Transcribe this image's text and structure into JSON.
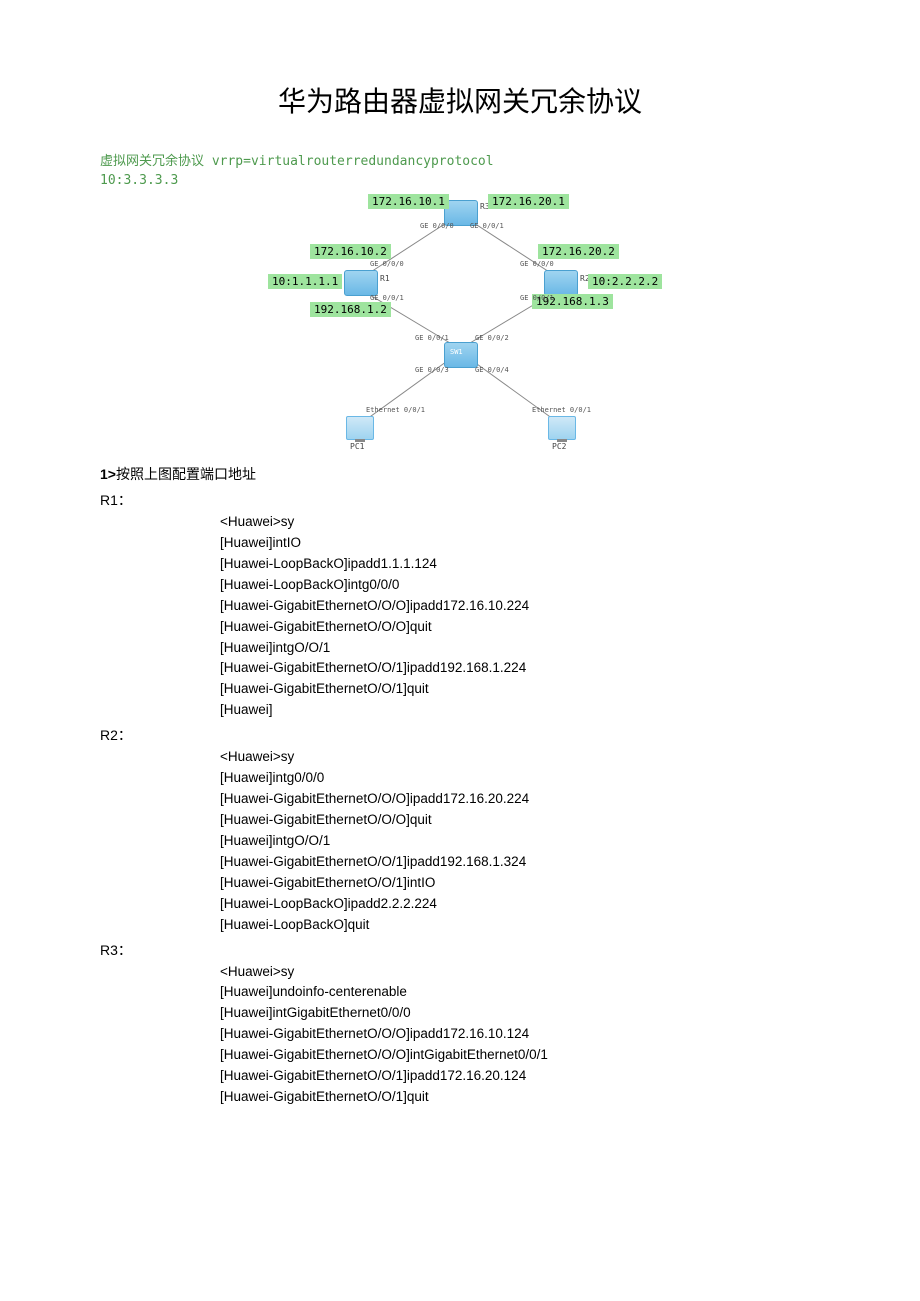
{
  "title": "华为路由器虚拟网关冗余协议",
  "greenHeading": "虚拟网关冗余协议 vrrp=virtualrouterredundancyprotocol",
  "greenSub": "10:3.3.3.3",
  "diagram": {
    "ips": {
      "r3_left": "172.16.10.1",
      "r3_right": "172.16.20.1",
      "r1_up": "172.16.10.2",
      "r2_up": "172.16.20.2",
      "r1_lo": "10:1.1.1.1",
      "r2_lo": "10:2.2.2.2",
      "r1_down": "192.168.1.2",
      "r2_down": "192.168.1.3"
    },
    "ports": {
      "ge000": "GE 0/0/0",
      "ge001": "GE 0/0/1",
      "ge002": "GE 0/0/2",
      "ge003": "GE 0/0/3",
      "ge004": "GE 0/0/4",
      "eth001": "Ethernet 0/0/1"
    },
    "devices": {
      "r1": "R1",
      "r2": "R2",
      "r3": "R3",
      "sw1": "SW1",
      "pc1": "PC1",
      "pc2": "PC2"
    }
  },
  "sectionHeading": "按照上图配置端口地址",
  "sectionNum": "1>",
  "r1Label": "R1：",
  "r1": [
    "<Huawei>sy",
    "[Huawei]intIO",
    "[Huawei-LoopBackO]ipadd1.1.1.124",
    "[Huawei-LoopBackO]intg0/0/0",
    "[Huawei-GigabitEthernetO/O/O]ipadd172.16.10.224",
    "[Huawei-GigabitEthernetO/O/O]quit",
    "[Huawei]intgO/O/1",
    "[Huawei-GigabitEthernetO/O/1]ipadd192.168.1.224",
    "[Huawei-GigabitEthernetO/O/1]quit",
    "[Huawei]"
  ],
  "r2Label": "R2：",
  "r2": [
    "<Huawei>sy",
    "[Huawei]intg0/0/0",
    "[Huawei-GigabitEthernetO/O/O]ipadd172.16.20.224",
    "[Huawei-GigabitEthernetO/O/O]quit",
    "[Huawei]intgO/O/1",
    "[Huawei-GigabitEthernetO/O/1]ipadd192.168.1.324",
    "[Huawei-GigabitEthernetO/O/1]intIO",
    "[Huawei-LoopBackO]ipadd2.2.2.224",
    "[Huawei-LoopBackO]quit"
  ],
  "r3Label": "R3：",
  "r3": [
    "<Huawei>sy",
    "[Huawei]undoinfo-centerenable",
    "[Huawei]intGigabitEthernet0/0/0",
    "[Huawei-GigabitEthernetO/O/O]ipadd172.16.10.124",
    "[Huawei-GigabitEthernetO/O/O]intGigabitEthernet0/0/1",
    "[Huawei-GigabitEthernetO/O/1]ipadd172.16.20.124",
    "[Huawei-GigabitEthernetO/O/1]quit"
  ]
}
